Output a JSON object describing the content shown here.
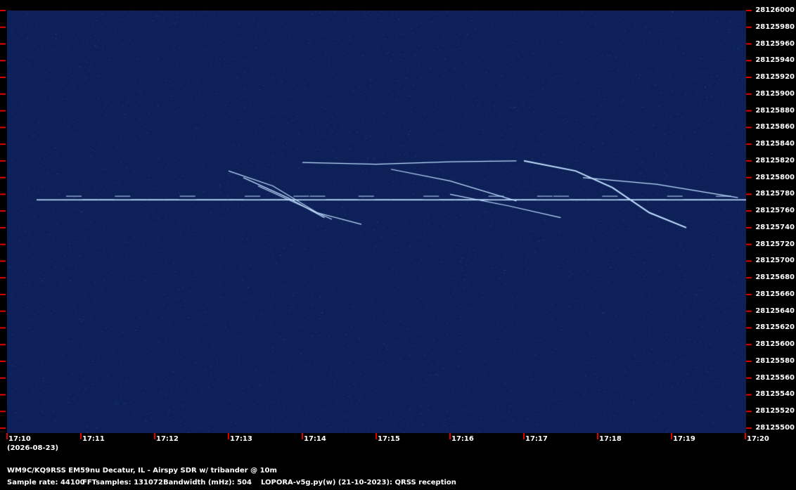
{
  "colors": {
    "background": "#000000",
    "plot": "#0d2057",
    "tick": "#dd0000",
    "trace": "#bfe0ff",
    "text": "#ffffff"
  },
  "chart_data": {
    "type": "heatmap",
    "title": "",
    "xlabel": "",
    "ylabel": "",
    "x_ticks": [
      "17:10",
      "17:11",
      "17:12",
      "17:13",
      "17:14",
      "17:15",
      "17:16",
      "17:17",
      "17:18",
      "17:19",
      "17:20"
    ],
    "x_date": "(2026-08-23)",
    "xlim": [
      "17:10",
      "17:20"
    ],
    "ylim": [
      28125500,
      28126000
    ],
    "y_ticks": [
      28126000,
      28125980,
      28125960,
      28125940,
      28125920,
      28125900,
      28125880,
      28125860,
      28125840,
      28125820,
      28125800,
      28125780,
      28125760,
      28125740,
      28125720,
      28125700,
      28125680,
      28125660,
      28125640,
      28125620,
      28125600,
      28125580,
      28125560,
      28125540,
      28125520,
      28125500
    ],
    "carrier_hz": 28125774,
    "grid": false,
    "legend": "none",
    "traces": [
      {
        "t": [
          13.0,
          13.6,
          14.2,
          14.8
        ],
        "f": [
          28125808,
          28125790,
          28125758,
          28125744
        ]
      },
      {
        "t": [
          13.2,
          13.8,
          14.3
        ],
        "f": [
          28125800,
          28125776,
          28125752
        ]
      },
      {
        "t": [
          13.4,
          13.9,
          14.4
        ],
        "f": [
          28125790,
          28125770,
          28125750
        ]
      },
      {
        "t": [
          14.0,
          15.0,
          16.0,
          16.9
        ],
        "f": [
          28125818,
          28125816,
          28125819,
          28125820
        ]
      },
      {
        "t": [
          15.2,
          16.0,
          16.9
        ],
        "f": [
          28125810,
          28125796,
          28125772
        ]
      },
      {
        "t": [
          16.0,
          16.8,
          17.5
        ],
        "f": [
          28125780,
          28125766,
          28125752
        ]
      },
      {
        "t": [
          17.0,
          17.7,
          18.2,
          18.7,
          19.2
        ],
        "f": [
          28125820,
          28125808,
          28125788,
          28125758,
          28125740
        ]
      },
      {
        "t": [
          17.8,
          18.8,
          19.9
        ],
        "f": [
          28125800,
          28125792,
          28125776
        ]
      }
    ]
  },
  "footer": {
    "station": "WM9C/KQ9RSS EM59nu Decatur, IL - Airspy SDR w/ tribander @ 10m",
    "sample_rate": "Sample rate: 44100",
    "fft_samples": "FFTsamples: 131072",
    "bandwidth": "Bandwidth (mHz): 504",
    "software": "LOPORA-v5g.py(w) (21-10-2023): QRSS reception"
  }
}
